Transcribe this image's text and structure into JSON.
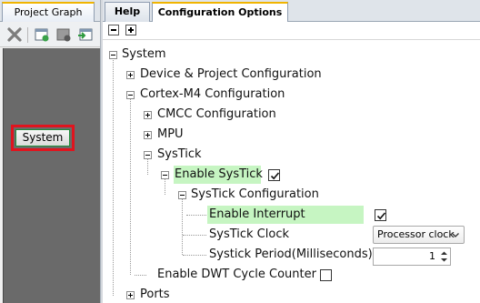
{
  "left_panel": {
    "tab_label": "Project Graph",
    "toolbar": {
      "icons": [
        "close-icon",
        "add-component-icon",
        "save-component-icon",
        "export-icon"
      ]
    },
    "graph": {
      "node_label": "System"
    }
  },
  "right_panel": {
    "tabs": [
      {
        "label": "Help"
      },
      {
        "label": "Configuration Options"
      }
    ],
    "toolbar": {
      "collapse_all": "−",
      "expand_all": "+"
    },
    "tree": {
      "system": "System",
      "device_project": "Device & Project Configuration",
      "cortex_m4": "Cortex-M4 Configuration",
      "cmcc": "CMCC Configuration",
      "mpu": "MPU",
      "systick": "SysTick",
      "enable_systick": "Enable SysTick",
      "systick_configuration": "SysTick Configuration",
      "enable_interrupt": "Enable Interrupt",
      "systick_clock": "SysTick Clock",
      "systick_period": "Systick Period(Milliseconds)",
      "enable_dwt": "Enable DWT Cycle Counter",
      "ports": "Ports"
    },
    "values": {
      "enable_systick_checked": true,
      "enable_interrupt_checked": true,
      "enable_dwt_checked": false,
      "systick_clock": "Processor clock",
      "systick_period": "1"
    },
    "colors": {
      "highlight": "#c6f5c2",
      "selected_node_border": "#e0141e",
      "tab_accent": "#f0b400"
    }
  }
}
